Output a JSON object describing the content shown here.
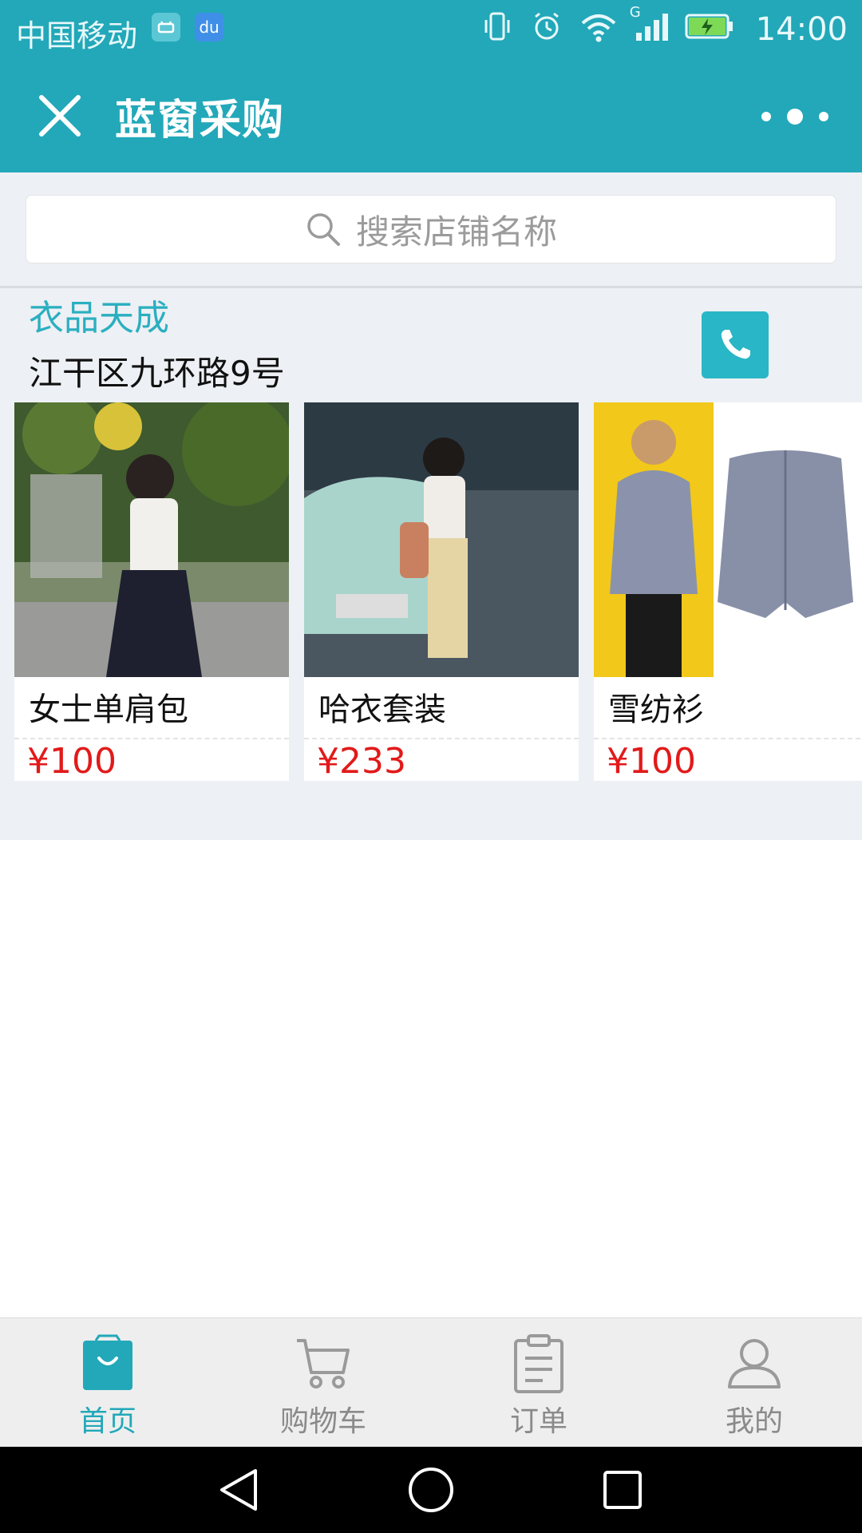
{
  "status_bar": {
    "carrier": "中国移动",
    "app_icon_baidu": "du",
    "signal_label": "G",
    "time": "14:00",
    "icons": [
      "android-icon",
      "baidu-icon",
      "vibrate-icon",
      "alarm-icon",
      "wifi-icon",
      "signal-icon",
      "battery-charging-icon"
    ]
  },
  "header": {
    "title": "蓝窗采购",
    "close_icon": "close-icon",
    "more_icon": "more-icon"
  },
  "search": {
    "placeholder": "搜索店铺名称",
    "icon": "search-icon"
  },
  "shop": {
    "name": "衣品天成",
    "address": "江干区九环路9号",
    "phone_icon": "phone-icon"
  },
  "products": [
    {
      "name": "女士单肩包",
      "price": "¥100"
    },
    {
      "name": "哈衣套装",
      "price": "¥233"
    },
    {
      "name": "雪纺衫",
      "price": "¥100"
    }
  ],
  "tabs": [
    {
      "label": "首页",
      "icon": "shopping-bag-icon",
      "active": true
    },
    {
      "label": "购物车",
      "icon": "cart-icon",
      "active": false
    },
    {
      "label": "订单",
      "icon": "clipboard-icon",
      "active": false
    },
    {
      "label": "我的",
      "icon": "user-icon",
      "active": false
    }
  ],
  "colors": {
    "brand": "#22a8b9",
    "price": "#e21a1a",
    "shop_name": "#2aafc0"
  }
}
